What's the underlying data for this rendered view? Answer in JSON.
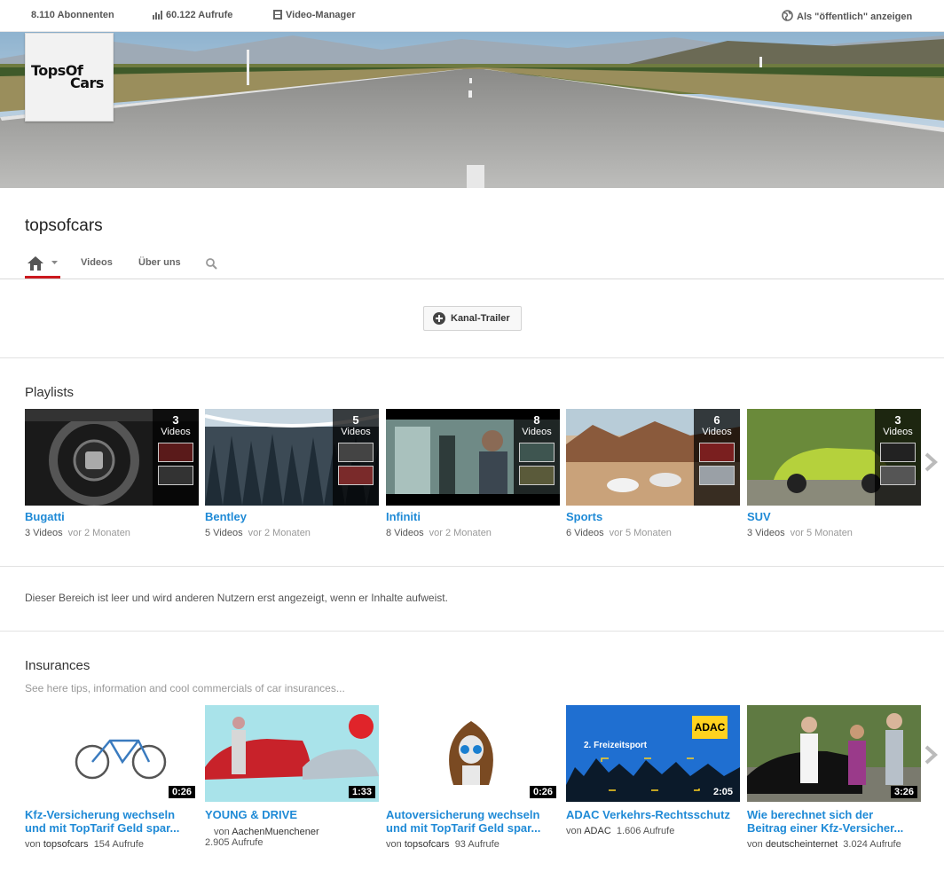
{
  "topbar": {
    "subscribers": "8.110 Abonnenten",
    "views": "60.122 Aufrufe",
    "video_manager": "Video-Manager",
    "view_as": "Als \"öffentlich\" anzeigen"
  },
  "avatar": {
    "line1": "TopsOf",
    "line2": "Cars"
  },
  "channel": {
    "name": "topsofcars"
  },
  "nav": {
    "videos": "Videos",
    "about": "Über uns"
  },
  "trailer": {
    "label": "Kanal-Trailer"
  },
  "playlists": {
    "title": "Playlists",
    "items": [
      {
        "title": "Bugatti",
        "count": "3",
        "count_label": "Videos",
        "meta": "3 Videos",
        "ago": "vor 2 Monaten"
      },
      {
        "title": "Bentley",
        "count": "5",
        "count_label": "Videos",
        "meta": "5 Videos",
        "ago": "vor 2 Monaten"
      },
      {
        "title": "Infiniti",
        "count": "8",
        "count_label": "Videos",
        "meta": "8 Videos",
        "ago": "vor 2 Monaten"
      },
      {
        "title": "Sports",
        "count": "6",
        "count_label": "Videos",
        "meta": "6 Videos",
        "ago": "vor 5 Monaten"
      },
      {
        "title": "SUV",
        "count": "3",
        "count_label": "Videos",
        "meta": "3 Videos",
        "ago": "vor 5 Monaten"
      }
    ]
  },
  "empty_section": {
    "text": "Dieser Bereich ist leer und wird anderen Nutzern erst angezeigt, wenn er Inhalte aufweist."
  },
  "insurances": {
    "title": "Insurances",
    "subtitle": "See here tips, information and cool commercials of car insurances...",
    "items": [
      {
        "line1": "Kfz-Versicherung wechseln",
        "line2": "und mit TopTarif Geld spar...",
        "duration": "0:26",
        "by": "von",
        "author": "topsofcars",
        "views": "154 Aufrufe"
      },
      {
        "line1": "YOUNG & DRIVE",
        "line2": "",
        "duration": "1:33",
        "by": "von",
        "author": "AachenMuenchener",
        "views": "2.905 Aufrufe"
      },
      {
        "line1": "Autoversicherung wechseln",
        "line2": "und mit TopTarif Geld spar...",
        "duration": "0:26",
        "by": "von",
        "author": "topsofcars",
        "views": "93 Aufrufe"
      },
      {
        "line1": "ADAC Verkehrs-Rechtsschutz",
        "line2": "",
        "duration": "2:05",
        "by": "von",
        "author": "ADAC",
        "views": "1.606 Aufrufe",
        "logo": "ADAC",
        "caption": "2. Freizeitsport"
      },
      {
        "line1": "Wie berechnet sich der",
        "line2": "Beitrag einer Kfz-Versicher...",
        "duration": "3:26",
        "by": "von",
        "author": "deutscheinternet",
        "views": "3.024 Aufrufe"
      }
    ]
  },
  "colors": {
    "link": "#1f8ad6",
    "accent": "#cc181e"
  }
}
